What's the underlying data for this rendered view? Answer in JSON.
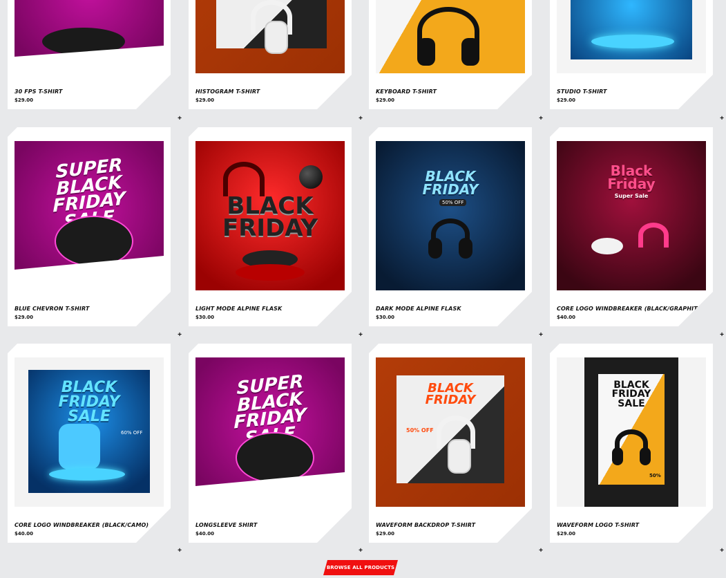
{
  "products": [
    {
      "title": "30 FPS T-Shirt",
      "price": "$29.00",
      "art": "pink-pods-cut"
    },
    {
      "title": "Histogram T-Shirt",
      "price": "$29.00",
      "art": "orange-headphones-cut"
    },
    {
      "title": "Keyboard T-Shirt",
      "price": "$29.00",
      "art": "yellow-headphones-cut"
    },
    {
      "title": "Studio T-Shirt",
      "price": "$29.00",
      "art": "blue-watch-cut"
    },
    {
      "title": "Blue Chevron T-Shirt",
      "price": "$29.00",
      "art": "pink-pods",
      "headline": "SUPER BLACK FRIDAY SALE"
    },
    {
      "title": "Light Mode Alpine Flask",
      "price": "$30.00",
      "art": "red-3d",
      "headline": "BLACK FRIDAY"
    },
    {
      "title": "Dark Mode Alpine Flask",
      "price": "$30.00",
      "art": "navy-headphones",
      "headline": "BLACK FRIDAY",
      "badge": "50% OFF"
    },
    {
      "title": "Core Logo Windbreaker (Black/Graphite)",
      "price": "$40.00",
      "art": "maroon-gaming",
      "headline": "Black Friday",
      "sub": "Super Sale"
    },
    {
      "title": "Core Logo Windbreaker (Black/Camo)",
      "price": "$40.00",
      "art": "blue-watch",
      "headline": "BLACK FRIDAY SALE",
      "badge": "60% OFF"
    },
    {
      "title": "Longsleeve Shirt",
      "price": "$40.00",
      "art": "pink-pods",
      "headline": "SUPER BLACK FRIDAY SALE"
    },
    {
      "title": "Waveform Backdrop T-Shirt",
      "price": "$29.00",
      "art": "orange-headphones",
      "headline": "BLACK FRIDAY",
      "badge": "50% OFF"
    },
    {
      "title": "Waveform Logo T-Shirt",
      "price": "$29.00",
      "art": "yellow-headphones",
      "headline": "BLACK FRIDAY SALE",
      "badge": "50%"
    }
  ],
  "browse_label": "BROWSE ALL PRODUCTS",
  "plus_symbol": "+",
  "colors": {
    "accent": "#f01010",
    "page_bg": "#e8e9eb"
  }
}
